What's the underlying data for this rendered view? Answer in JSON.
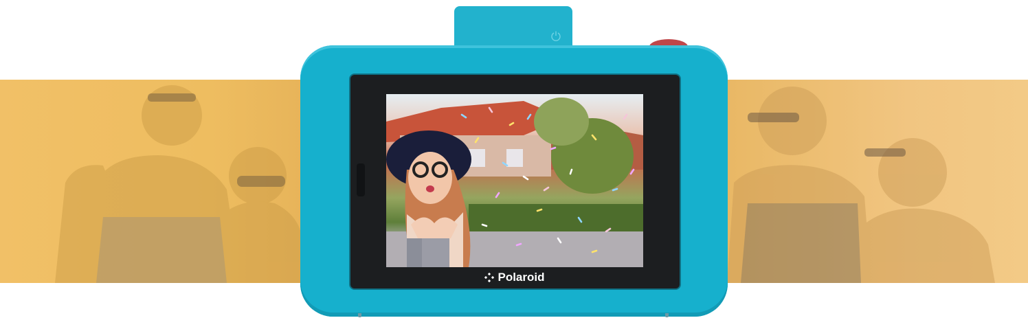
{
  "brand": {
    "logo_text": "Polaroid",
    "accent_color": "#16b0cd",
    "banner_color": "#f1c067"
  },
  "camera": {
    "body_color": "#16b0cd",
    "shutter_color": "#c0474a",
    "power_icon": "power-icon",
    "screen_scene": "selfie"
  },
  "banners": {
    "left_scene": "couple-laughing",
    "right_scene": "friends-laughing"
  }
}
